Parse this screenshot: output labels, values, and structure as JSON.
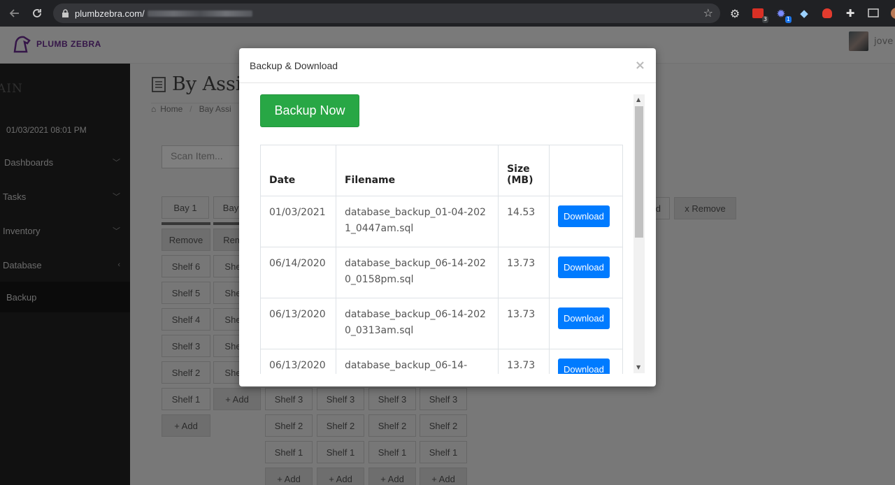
{
  "browser": {
    "url_prefix": "plumbzebra.com/",
    "extension_badges": [
      "3",
      "1"
    ]
  },
  "header": {
    "logo_text": "PLUMB ZEBRA",
    "user_name": "jove"
  },
  "sidebar": {
    "brand": "AIN",
    "datetime": "01/03/2021 08:01 PM",
    "items": [
      {
        "label": "Dashboards"
      },
      {
        "label": "Tasks"
      },
      {
        "label": "Inventory"
      },
      {
        "label": "Database"
      },
      {
        "label": "Backup"
      }
    ]
  },
  "main": {
    "title": "By Assi",
    "breadcrumb": [
      "Home",
      "Bay Assi"
    ],
    "scan_placeholder": "Scan Item...",
    "bay_tabs": [
      "Bay 1",
      "Bay"
    ],
    "remove_label": "Remove",
    "remove_partial": "Rem",
    "right_add": "d",
    "right_remove": "x Remove",
    "col1_shelves": [
      "Shelf 6",
      "Shelf 5",
      "Shelf 4",
      "Shelf 3",
      "Shelf 2",
      "Shelf 1"
    ],
    "col2_shelves_partial": "She",
    "add_label": "+ Add",
    "grid_shelves": [
      "Shelf 3",
      "Shelf 2",
      "Shelf 1"
    ]
  },
  "modal": {
    "title": "Backup & Download",
    "close": "×",
    "backup_button": "Backup Now",
    "table": {
      "headers": [
        "Date",
        "Filename",
        "Size (MB)",
        ""
      ],
      "rows": [
        {
          "date": "01/03/2021",
          "filename": "database_backup_01-04-2021_0447am.sql",
          "size": "14.53",
          "action": "Download"
        },
        {
          "date": "06/14/2020",
          "filename": "database_backup_06-14-2020_0158pm.sql",
          "size": "13.73",
          "action": "Download"
        },
        {
          "date": "06/13/2020",
          "filename": "database_backup_06-14-2020_0313am.sql",
          "size": "13.73",
          "action": "Download"
        },
        {
          "date": "06/13/2020",
          "filename": "database_backup_06-14-",
          "size": "13.73",
          "action": "Download"
        }
      ]
    }
  }
}
